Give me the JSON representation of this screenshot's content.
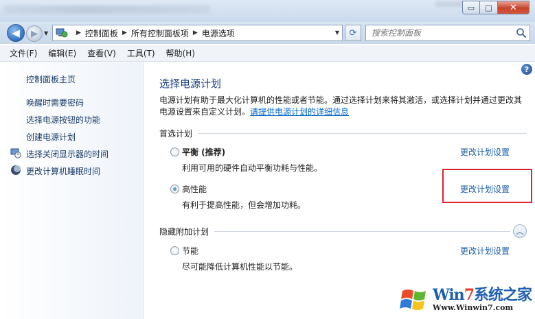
{
  "window": {
    "buttons": {
      "min": "▭",
      "max": "□",
      "close": "✕"
    }
  },
  "address": {
    "crumbs": [
      "控制面板",
      "所有控制面板项",
      "电源选项"
    ],
    "search_placeholder": "搜索控制面板"
  },
  "menu": [
    "文件(F)",
    "编辑(E)",
    "查看(V)",
    "工具(T)",
    "帮助(H)"
  ],
  "sidebar": {
    "home": "控制面板主页",
    "links": [
      "唤醒时需要密码",
      "选择电源按钮的功能",
      "创建电源计划",
      "选择关闭显示器的时间",
      "更改计算机睡眠时间"
    ],
    "icons": [
      "monitor-clock-icon",
      "moon-icon"
    ]
  },
  "main": {
    "help": "?",
    "title": "选择电源计划",
    "description": "电源计划有助于最大化计算机的性能或者节能。通过选择计划来将其激活，或选择计划并通过更改其电源设置来自定义计划。",
    "description_link": "请提供电源计划的详细信息",
    "preferred_section": "首选计划",
    "hidden_section": "隐藏附加计划",
    "plans": [
      {
        "name": "平衡 (推荐)",
        "desc": "利用可用的硬件自动平衡功耗与性能。",
        "selected": false,
        "change": "更改计划设置"
      },
      {
        "name": "高性能",
        "desc": "有利于提高性能，但会增加功耗。",
        "selected": true,
        "change": "更改计划设置"
      },
      {
        "name": "节能",
        "desc": "尽可能降低计算机性能以节能。",
        "selected": false,
        "change": "更改计划设置"
      }
    ],
    "highlight_color": "#d9262c"
  },
  "watermark": {
    "brand_a": "Win",
    "brand_b": "7",
    "brand_c": "系统之家",
    "url": "Www.Winwin7.com"
  }
}
